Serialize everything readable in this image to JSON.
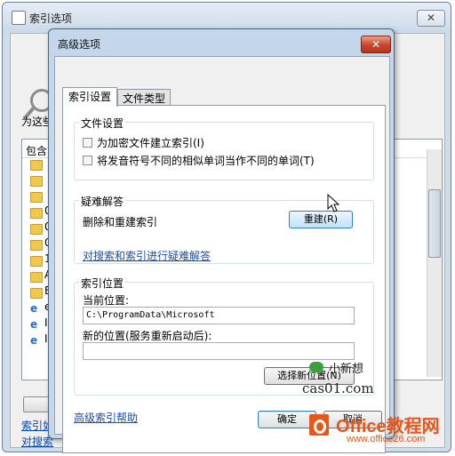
{
  "outer_window": {
    "title": "索引选项",
    "close_glyph": "✕",
    "modify_prefix": "为这些",
    "list_header": "包含",
    "list_rows": [
      "",
      "",
      "0",
      "0",
      "0",
      "1",
      "A",
      "E",
      "e",
      "I",
      "I"
    ],
    "link1": "索引如",
    "link2": "对搜索"
  },
  "dialog": {
    "title": "高级选项",
    "close_glyph": "✕",
    "tabs": [
      {
        "label": "索引设置",
        "active": true
      },
      {
        "label": "文件类型",
        "active": false
      }
    ],
    "file_settings": {
      "title": "文件设置",
      "options": [
        {
          "label": "为加密文件建立索引(I)",
          "checked": false
        },
        {
          "label": "将发音符号不同的相似单词当作不同的单词(T)",
          "checked": false
        }
      ]
    },
    "troubleshooting": {
      "title": "疑难解答",
      "rebuild_label": "删除和重建索引",
      "rebuild_button": "重建(R)",
      "troubleshoot_link": "对搜索和索引进行疑难解答"
    },
    "index_location": {
      "title": "索引位置",
      "current_label": "当前位置:",
      "current_value": "C:\\ProgramData\\Microsoft",
      "new_label": "新的位置(服务重新启动后):",
      "new_value": "",
      "select_button": "选择新位置(N)"
    },
    "help_link": "高级索引帮助",
    "ok_button": "确定",
    "cancel_button": "取消"
  },
  "watermark": {
    "line1": "小新想",
    "line2": "cas01.com",
    "brand": "Office教程网",
    "url": "www.office26.com"
  },
  "colors": {
    "link": "#1a4fad",
    "close_button": "#c9452a",
    "brand_orange": "#e8561a",
    "dialog_frame": "#c4d6ea"
  }
}
